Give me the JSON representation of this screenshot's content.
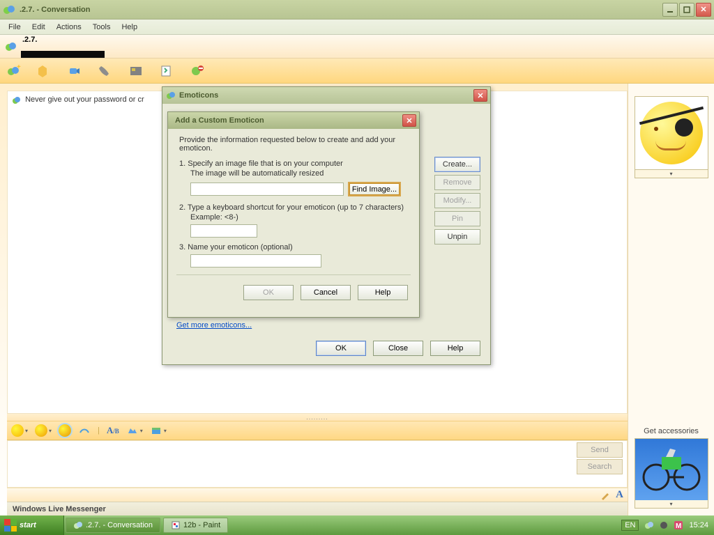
{
  "window": {
    "title": ".2.7.  - Conversation",
    "menu": {
      "file": "File",
      "edit": "Edit",
      "actions": "Actions",
      "tools": "Tools",
      "help": "Help"
    },
    "contact_name": ".2.7.",
    "warning_text": "Never give out your password or cr",
    "splitter": ".........",
    "compose_buttons": {
      "send": "Send",
      "search": "Search"
    },
    "brand": "Windows Live Messenger",
    "accessories_label": "Get accessories"
  },
  "emoticons_dialog": {
    "title": "Emoticons",
    "side": {
      "create": "Create...",
      "remove": "Remove",
      "modify": "Modify...",
      "pin": "Pin",
      "unpin": "Unpin"
    },
    "link": "Get more emoticons...",
    "buttons": {
      "ok": "OK",
      "close": "Close",
      "help": "Help"
    }
  },
  "custom_dialog": {
    "title": "Add a Custom Emoticon",
    "intro": "Provide the information requested below to create and add your emoticon.",
    "step1": "1.   Specify an image file that is on your computer",
    "step1_sub": "The image will be automatically resized",
    "find_image": "Find Image...",
    "step2": "2.   Type a keyboard shortcut for your emoticon (up to 7 characters)",
    "step2_sub": "Example: <8-)",
    "step3": "3.   Name your emoticon (optional)",
    "buttons": {
      "ok": "OK",
      "cancel": "Cancel",
      "help": "Help"
    }
  },
  "taskbar": {
    "start": "start",
    "task1": ".2.7.  - Conversation",
    "task2": "12b - Paint",
    "lang": "EN",
    "clock": "15:24"
  }
}
